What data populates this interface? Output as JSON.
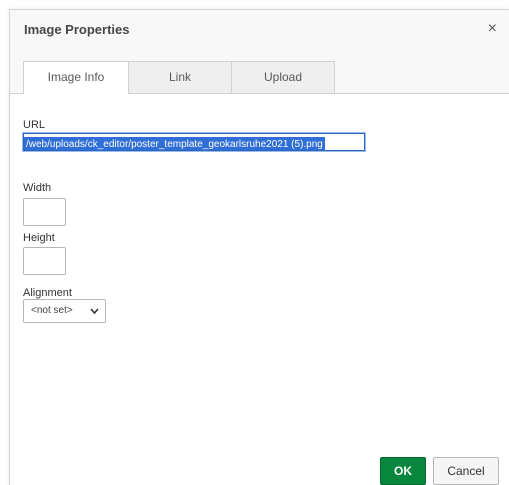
{
  "dialog": {
    "title": "Image Properties",
    "close_glyph": "×"
  },
  "tabs": [
    {
      "label": "Image Info",
      "active": true
    },
    {
      "label": "Link",
      "active": false
    },
    {
      "label": "Upload",
      "active": false
    }
  ],
  "fields": {
    "url_label": "URL",
    "url_value": "/web/uploads/ck_editor/poster_template_geokarlsruhe2021 (5).png",
    "width_label": "Width",
    "width_value": "",
    "height_label": "Height",
    "height_value": "",
    "alignment_label": "Alignment",
    "alignment_value": "<not set>"
  },
  "buttons": {
    "ok_label": "OK",
    "cancel_label": "Cancel"
  },
  "colors": {
    "ok_button": "#09863e",
    "url_selection": "#2f6ed6"
  }
}
